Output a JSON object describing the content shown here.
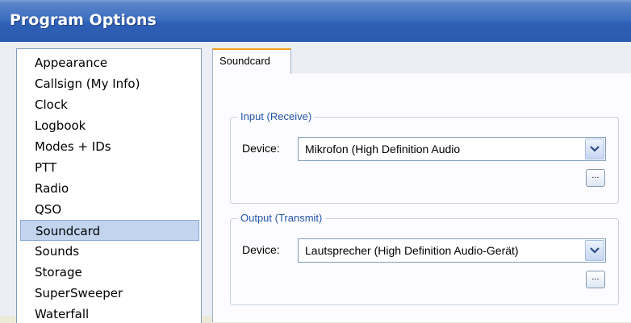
{
  "window": {
    "title": "Program Options"
  },
  "sidebar": {
    "items": [
      {
        "label": "Appearance"
      },
      {
        "label": "Callsign (My Info)"
      },
      {
        "label": "Clock"
      },
      {
        "label": "Logbook"
      },
      {
        "label": "Modes + IDs"
      },
      {
        "label": "PTT"
      },
      {
        "label": "Radio"
      },
      {
        "label": "QSO"
      },
      {
        "label": "Soundcard"
      },
      {
        "label": "Sounds"
      },
      {
        "label": "Storage"
      },
      {
        "label": "SuperSweeper"
      },
      {
        "label": "Waterfall"
      }
    ],
    "selected": "Soundcard"
  },
  "tabs": [
    {
      "label": "Soundcard"
    }
  ],
  "input_group": {
    "legend": "Input (Receive)",
    "device_label": "Device:",
    "device_value": "Mikrofon (High Definition Audio",
    "browse_label": "..."
  },
  "output_group": {
    "legend": "Output (Transmit)",
    "device_label": "Device:",
    "device_value": "Lautsprecher (High Definition Audio-Gerät)",
    "browse_label": "..."
  },
  "colors": {
    "titlebar": "#2e60b6",
    "selection": "#c2d4ee",
    "legend_text": "#2255a8",
    "tab_accent": "#f0a020"
  }
}
